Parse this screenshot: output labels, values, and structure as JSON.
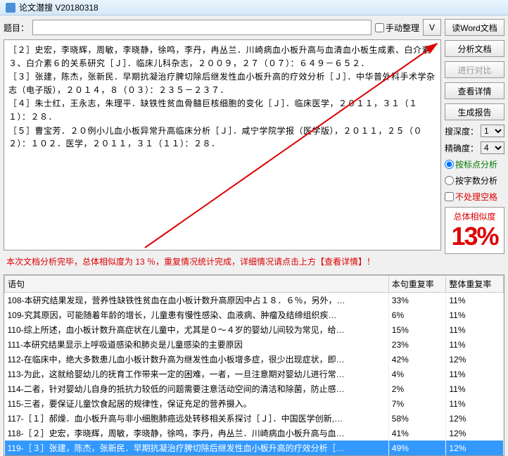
{
  "titlebar": {
    "title": "论文潜搜 V20180318"
  },
  "topic": {
    "label": "题目：",
    "value": "",
    "manual_label": "手动整理",
    "v_button": "V"
  },
  "side_buttons": {
    "read_word": "读Word文档",
    "analyze": "分析文档",
    "compare": "进行对比",
    "details": "查看详情",
    "report": "生成报告"
  },
  "settings": {
    "depth_label": "搜深度：",
    "depth_value": "1",
    "accuracy_label": "精确度：",
    "accuracy_value": "4",
    "by_punct": "按标点分析",
    "by_count": "按字数分析",
    "ignore_space": "不处理空格"
  },
  "similarity": {
    "label": "总体相似度",
    "value": "13%"
  },
  "references": [
    "［２］史宏，李晓辉，周敏，李晓静，徐鸣，李丹，冉丛兰．川崎病血小板升高与血清血小板生成素、白介素３、白介素６的关系研究［Ｊ］．临床儿科杂志，２００９，２７（０７）：６４９－６５２．",
    "［３］张建，陈杰，张新民．早期抗凝治疗脾切除后继发性血小板升高的疗效分析［Ｊ］．中华普外科手术学杂志（电子版），２０１４，８（０３）：２３５－２３７．",
    "［４］朱士红，王永志，朱理平．缺铁性贫血骨髓巨核细胞的变化［Ｊ］．临床医学，２０１１，３１（１１）：２８．",
    "［５］曹宝芳．２０例小儿血小板异常升高临床分析［Ｊ］．咸宁学院学报（医学版），２０１１，２５（０２）：１０２．医学，２０１１，３１（１１）：２８．"
  ],
  "status_line": "本次文档分析完毕，总体相似度为 13 ％，重复情况统计完成，详细情况请点击上方【查看详情】！",
  "table": {
    "headers": {
      "sentence": "语句",
      "rate1": "本句重复率",
      "rate2": "整体重复率"
    },
    "rows": [
      {
        "s": "108-本研究结果发现，营养性缺铁性贫血在血小板计数升高原因中占１８．６％，另外，…",
        "r1": "33%",
        "r2": "11%"
      },
      {
        "s": "109-究其原因，可能随着年龄的增长，儿童患有慢性感染、血液病、肿瘤及结缔组织疾…",
        "r1": "6%",
        "r2": "11%"
      },
      {
        "s": "110-综上所述，血小板计数升高症状在儿童中，尤其是０～４岁的婴幼儿间较为常见，给…",
        "r1": "15%",
        "r2": "11%"
      },
      {
        "s": "111-本研究结果显示上呼吸道感染和肺炎是儿童感染的主要原因",
        "r1": "23%",
        "r2": "11%"
      },
      {
        "s": "112-在临床中，绝大多数患儿血小板计数升高为继发性血小板增多症，很少出现症状，即…",
        "r1": "42%",
        "r2": "12%"
      },
      {
        "s": "113-为此，这就给婴幼儿的抚育工作带来一定的困难，一者，一旦注意期对婴幼儿进行常…",
        "r1": "4%",
        "r2": "11%"
      },
      {
        "s": "114-二者，针对婴幼儿自身的抵抗力较低的问题需要注意活动空间的清洁和除菌，防止感…",
        "r1": "2%",
        "r2": "11%"
      },
      {
        "s": "115-三者，要保证儿童饮食起居的规律性，保证充足的营养摄入。",
        "r1": "7%",
        "r2": "11%"
      },
      {
        "s": "117-［１］郝燥．血小板升高与非小细胞肺癌远处转移相关系探讨［Ｊ］．中国医学创新,…",
        "r1": "58%",
        "r2": "12%"
      },
      {
        "s": "118-［２］史宏，李晓辉，周敏，李晓静，徐鸣，李丹，冉丛兰．川崎病血小板升高与血…",
        "r1": "41%",
        "r2": "12%"
      },
      {
        "s": "119-［３］张建，陈杰，张新民．早期抗凝治疗脾切除后继发性血小板升高的疗效分析［…",
        "r1": "49%",
        "r2": "12%",
        "selected": true
      }
    ]
  }
}
